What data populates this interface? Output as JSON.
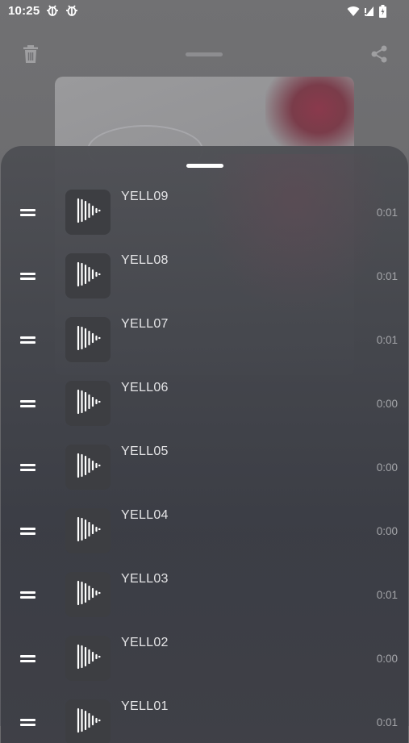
{
  "status_bar": {
    "time": "10:25",
    "app_icons": [
      "bug-icon",
      "bug-icon"
    ],
    "right_icons": [
      "wifi-icon",
      "signal-icon",
      "battery-icon"
    ]
  },
  "player": {
    "top_bar": [
      "trash-icon",
      "drag-handle",
      "share-icon"
    ],
    "cover_art": "album-artwork"
  },
  "playlist": {
    "tracks": [
      {
        "title": "YELL09",
        "duration": "0:01"
      },
      {
        "title": "YELL08",
        "duration": "0:01"
      },
      {
        "title": "YELL07",
        "duration": "0:01"
      },
      {
        "title": "YELL06",
        "duration": "0:00"
      },
      {
        "title": "YELL05",
        "duration": "0:00"
      },
      {
        "title": "YELL04",
        "duration": "0:00"
      },
      {
        "title": "YELL03",
        "duration": "0:01"
      },
      {
        "title": "YELL02",
        "duration": "0:00"
      },
      {
        "title": "YELL01",
        "duration": "0:01"
      }
    ]
  },
  "colors": {
    "sheet": "#46474d",
    "title_text": "#e4e4e6",
    "duration_text": "#a5a6aa",
    "thumb": "#3d3e42"
  }
}
